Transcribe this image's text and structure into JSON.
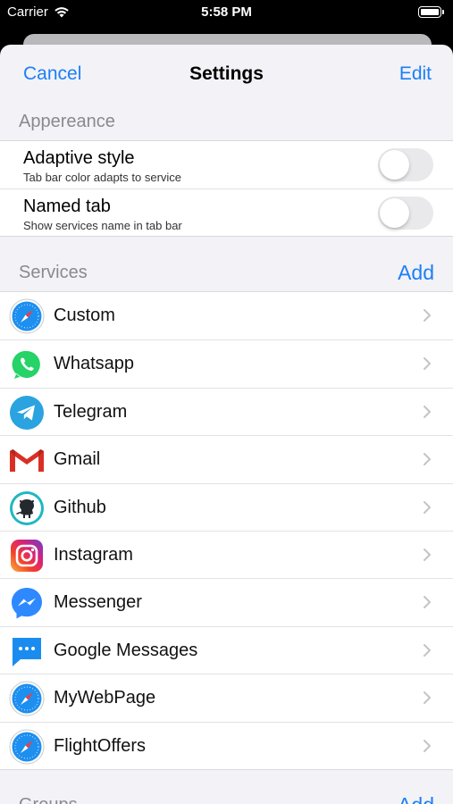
{
  "status_bar": {
    "carrier": "Carrier",
    "time": "5:58 PM"
  },
  "nav": {
    "cancel": "Cancel",
    "title": "Settings",
    "edit": "Edit"
  },
  "appearance": {
    "header": "Appereance",
    "rows": [
      {
        "title": "Adaptive style",
        "subtitle": "Tab bar color adapts to service",
        "on": false
      },
      {
        "title": "Named tab",
        "subtitle": "Show services name in tab bar",
        "on": false
      }
    ]
  },
  "services": {
    "header": "Services",
    "action": "Add",
    "items": [
      {
        "name": "Custom",
        "icon": "safari-icon"
      },
      {
        "name": "Whatsapp",
        "icon": "whatsapp-icon"
      },
      {
        "name": "Telegram",
        "icon": "telegram-icon"
      },
      {
        "name": "Gmail",
        "icon": "gmail-icon"
      },
      {
        "name": "Github",
        "icon": "github-icon"
      },
      {
        "name": "Instagram",
        "icon": "instagram-icon"
      },
      {
        "name": "Messenger",
        "icon": "messenger-icon"
      },
      {
        "name": "Google Messages",
        "icon": "google-messages-icon"
      },
      {
        "name": "MyWebPage",
        "icon": "safari-icon"
      },
      {
        "name": "FlightOffers",
        "icon": "safari-icon"
      }
    ]
  },
  "groups": {
    "header": "Groups",
    "action": "Add"
  },
  "colors": {
    "accent": "#1c7ff5",
    "background": "#f2f2f7",
    "secondary_text": "#8a8a8e"
  }
}
